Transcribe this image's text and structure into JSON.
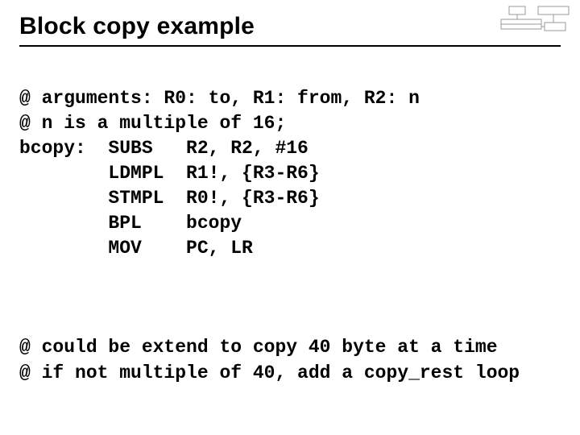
{
  "title": "Block copy example",
  "code": {
    "line1": "@ arguments: R0: to, R1: from, R2: n",
    "line2": "@ n is a multiple of 16;",
    "line3": "bcopy:  SUBS   R2, R2, #16",
    "line4": "        LDMPL  R1!, {R3-R6}",
    "line5": "        STMPL  R0!, {R3-R6}",
    "line6": "        BPL    bcopy",
    "line7": "        MOV    PC, LR",
    "line8": "@ could be extend to copy 40 byte at a time",
    "line9": "@ if not multiple of 40, add a copy_rest loop"
  }
}
